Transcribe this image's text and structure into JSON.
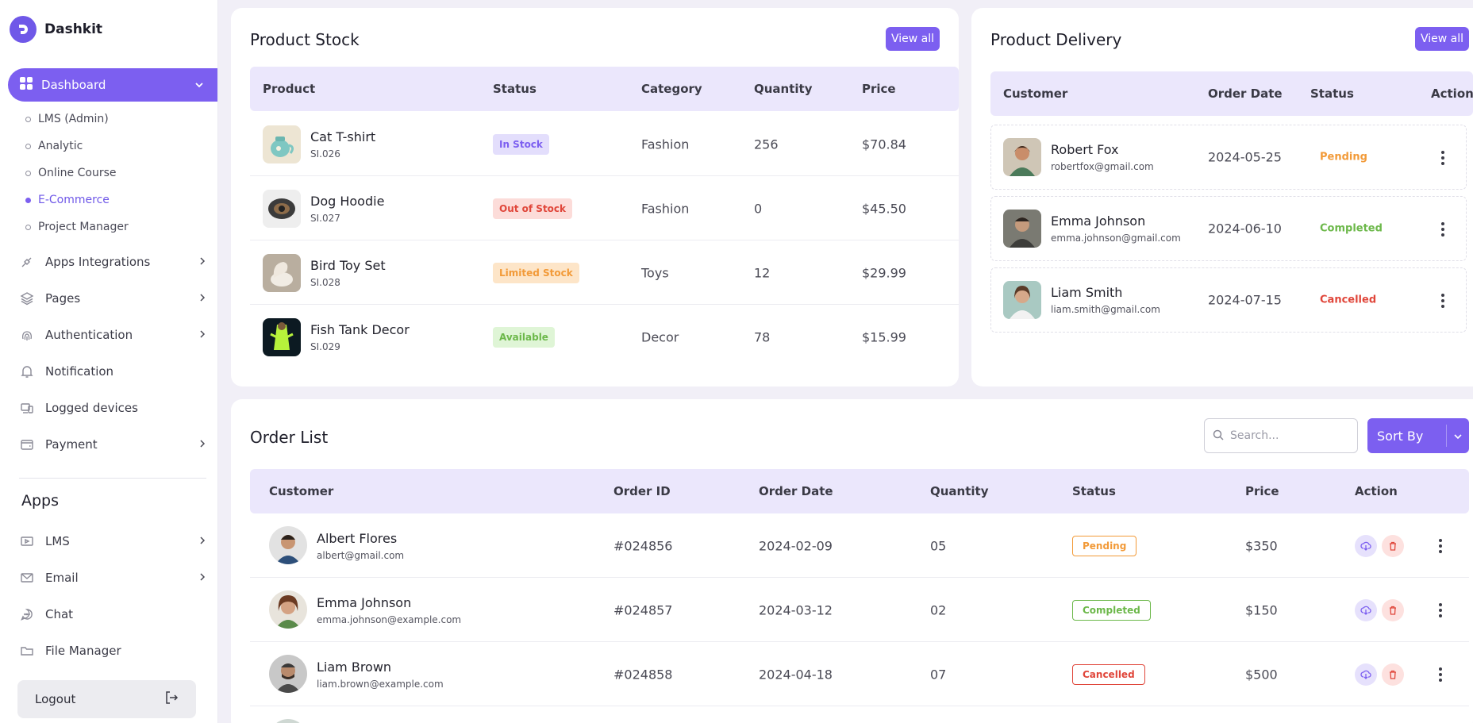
{
  "brand": {
    "name": "Dashkit"
  },
  "sidebar": {
    "active": {
      "label": "Dashboard"
    },
    "sub_items": [
      {
        "label": "LMS (Admin)"
      },
      {
        "label": "Analytic"
      },
      {
        "label": "Online Course"
      },
      {
        "label": "E-Commerce"
      },
      {
        "label": "Project Manager"
      }
    ],
    "items": [
      {
        "label": "Apps Integrations",
        "icon": "plug-icon"
      },
      {
        "label": "Pages",
        "icon": "layers-icon"
      },
      {
        "label": "Authentication",
        "icon": "fingerprint-icon"
      },
      {
        "label": "Notification",
        "icon": "bell-icon"
      },
      {
        "label": "Logged devices",
        "icon": "devices-icon"
      },
      {
        "label": "Payment",
        "icon": "wallet-icon"
      }
    ],
    "apps_title": "Apps",
    "apps": [
      {
        "label": "LMS",
        "icon": "lms-icon"
      },
      {
        "label": "Email",
        "icon": "mail-icon"
      },
      {
        "label": "Chat",
        "icon": "chat-icon"
      },
      {
        "label": "File Manager",
        "icon": "folder-icon"
      }
    ],
    "logout": "Logout"
  },
  "product_stock": {
    "title": "Product Stock",
    "view_all": "View all",
    "columns": [
      "Product",
      "Status",
      "Category",
      "Quantity",
      "Price"
    ],
    "rows": [
      {
        "name": "Cat T-shirt",
        "sku": "SI.026",
        "status": "In Stock",
        "category": "Fashion",
        "quantity": "256",
        "price": "$70.84"
      },
      {
        "name": "Dog Hoodie",
        "sku": "SI.027",
        "status": "Out of Stock",
        "category": "Fashion",
        "quantity": "0",
        "price": "$45.50"
      },
      {
        "name": "Bird Toy Set",
        "sku": "SI.028",
        "status": "Limited Stock",
        "category": "Toys",
        "quantity": "12",
        "price": "$29.99"
      },
      {
        "name": "Fish Tank Decor",
        "sku": "SI.029",
        "status": "Available",
        "category": "Decor",
        "quantity": "78",
        "price": "$15.99"
      }
    ]
  },
  "product_delivery": {
    "title": "Product Delivery",
    "view_all": "View all",
    "columns": [
      "Customer",
      "Order Date",
      "Status",
      "Action"
    ],
    "rows": [
      {
        "name": "Robert Fox",
        "email": "robertfox@gmail.com",
        "date": "2024-05-25",
        "status": "Pending"
      },
      {
        "name": "Emma Johnson",
        "email": "emma.johnson@gmail.com",
        "date": "2024-06-10",
        "status": "Completed"
      },
      {
        "name": "Liam Smith",
        "email": "liam.smith@gmail.com",
        "date": "2024-07-15",
        "status": "Cancelled"
      }
    ]
  },
  "order_list": {
    "title": "Order List",
    "search_placeholder": "Search...",
    "sort_by": "Sort By",
    "columns": [
      "Customer",
      "Order ID",
      "Order Date",
      "Quantity",
      "Status",
      "Price",
      "Action"
    ],
    "rows": [
      {
        "name": "Albert Flores",
        "email": "albert@gmail.com",
        "order_id": "#024856",
        "date": "2024-02-09",
        "quantity": "05",
        "status": "Pending",
        "price": "$350"
      },
      {
        "name": "Emma Johnson",
        "email": "emma.johnson@example.com",
        "order_id": "#024857",
        "date": "2024-03-12",
        "quantity": "02",
        "status": "Completed",
        "price": "$150"
      },
      {
        "name": "Liam Brown",
        "email": "liam.brown@example.com",
        "order_id": "#024858",
        "date": "2024-04-18",
        "quantity": "07",
        "status": "Cancelled",
        "price": "$500"
      }
    ]
  },
  "colors": {
    "accent": "#7c5ff0",
    "pending": "#f29a38",
    "completed": "#6cb84a",
    "cancelled": "#e0463a"
  }
}
